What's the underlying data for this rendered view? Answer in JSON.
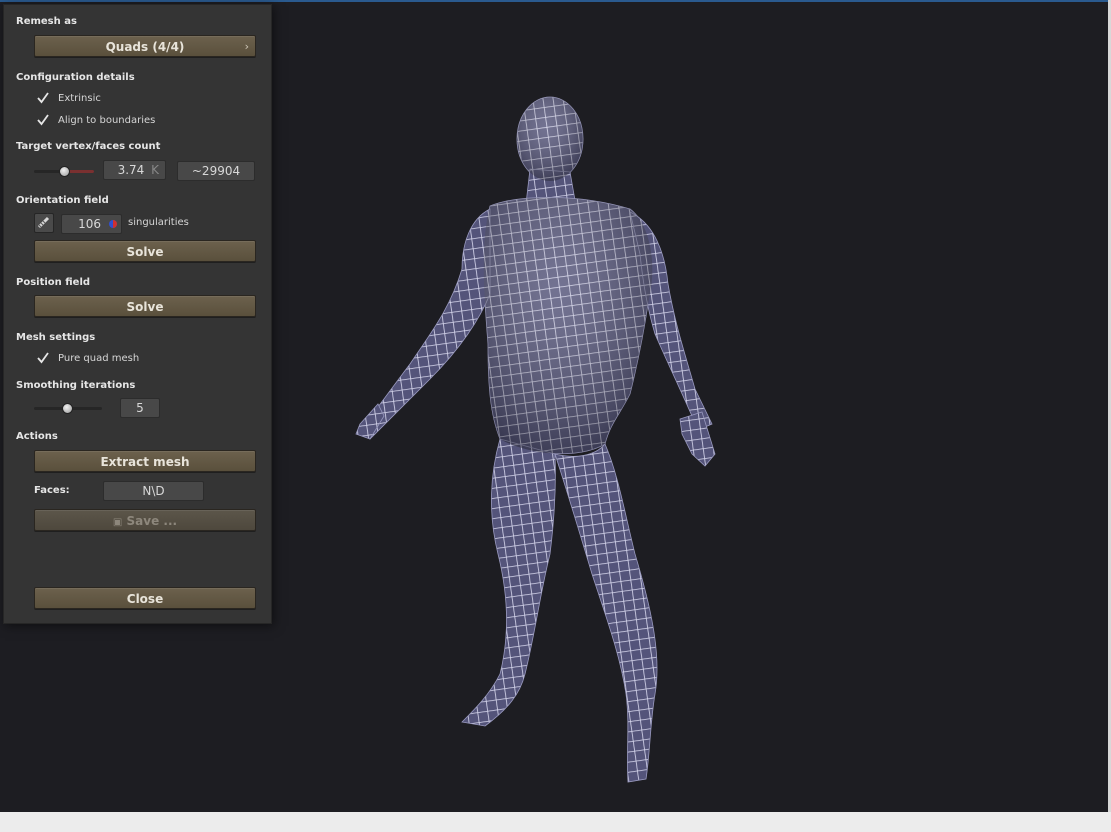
{
  "panel": {
    "remesh_as": {
      "label": "Remesh as",
      "button": "Quads (4/4)",
      "chevron": "›"
    },
    "config": {
      "label": "Configuration details",
      "extrinsic": "Extrinsic",
      "align": "Align to boundaries",
      "extrinsic_checked": true,
      "align_checked": true
    },
    "target": {
      "label": "Target vertex/faces count",
      "value": "3.74",
      "unit": "K",
      "faces": "~29904"
    },
    "orientation": {
      "label": "Orientation field",
      "count": "106",
      "suffix": "singularities",
      "solve": "Solve"
    },
    "position": {
      "label": "Position field",
      "solve": "Solve"
    },
    "mesh_settings": {
      "label": "Mesh settings",
      "pure_quad": "Pure quad mesh",
      "pure_quad_checked": true
    },
    "smoothing": {
      "label": "Smoothing iterations",
      "value": "5"
    },
    "actions": {
      "label": "Actions",
      "extract": "Extract mesh",
      "faces_label": "Faces:",
      "faces_value": "N\\D",
      "save": "Save ..."
    },
    "close": "Close"
  },
  "colors": {
    "button_bg": "#64594a",
    "panel_bg": "#343434",
    "viewport_bg": "#1d1d22",
    "mesh_fill": "#5a5a82",
    "mesh_lines": "#dcdcf0",
    "slider_fill": "#7a3030"
  },
  "icons": {
    "check": "check-icon",
    "chevron": "chevron-right-icon",
    "orientation_tool": "comb-icon",
    "singularity": "singularity-dot-icon",
    "save": "floppy-disk-icon"
  }
}
